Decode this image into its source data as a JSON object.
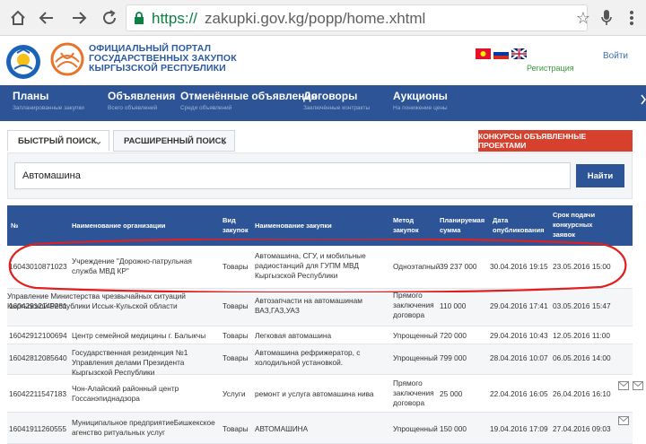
{
  "browser": {
    "url_protocol": "https://",
    "url_rest": "zakupki.gov.kg/popp/home.xhtml",
    "icons": [
      "home-icon",
      "back-icon",
      "forward-icon",
      "refresh-icon",
      "lock-icon",
      "star-icon",
      "mic-icon",
      "menu-icon"
    ]
  },
  "portal": {
    "title_lines": [
      "ОФИЦИАЛЬНЫЙ ПОРТАЛ",
      "ГОСУДАРСТВЕННЫХ ЗАКУПОК",
      "КЫРГЫЗСКОЙ РЕСПУБЛИКИ"
    ],
    "register": "Регистрация",
    "login": "Войти"
  },
  "nav": [
    {
      "label": "Планы",
      "sub": "Запланированные закупки"
    },
    {
      "label": "Объявления",
      "sub": "Всего объявлений"
    },
    {
      "label": "Отменённые объявления",
      "sub": "Среди объявлений"
    },
    {
      "label": "Договоры",
      "sub": "Заключённые контракты"
    },
    {
      "label": "Аукционы",
      "sub": "На понижение цены"
    }
  ],
  "search": {
    "quick_tab": "БЫСТРЫЙ ПОИСК",
    "advanced_tab": "РАСШИРЕННЫЙ ПОИСК",
    "projects_button": "КОНКУРСЫ ОБЪЯВЛЕННЫЕ ПРОЕКТАМИ",
    "query": "Автомашина",
    "find_button": "Найти"
  },
  "table": {
    "headers": [
      "№",
      "Наименование организации",
      "Вид закупок",
      "Наименование закупки",
      "Метод закупок",
      "Планируемая сумма",
      "Дата опубликования",
      "Срок подачи конкурсных заявок"
    ],
    "rows": [
      {
        "num": "16043010871023",
        "org": "Учреждение \"Дорожно-патрульная служба МВД КР\"",
        "kind": "Товары",
        "name": "Автомашина, СГУ, и мобильные радиостанций для ГУПМ МВД Кыргызской Республики",
        "method": "Одноэтапный",
        "sum": "39 237 000",
        "date": "30.04.2016 19:15",
        "deadline": "23.05.2016 15:00"
      },
      {
        "num": "16042912149281",
        "org": "Управление Министерства чрезвычайных ситуаций Кыргызской Республики Иссык-Кульской области",
        "kind": "Товары",
        "name": "Автозапчасти на автомашинам ВАЗ,ГАЗ,УАЗ",
        "method": "Прямого заключения договора",
        "sum": "110 000",
        "date": "29.04.2016 17:41",
        "deadline": "03.05.2016 15:47"
      },
      {
        "num": "16042912100694",
        "org": "Центр семейной медицины г. Балыкчы",
        "kind": "Товары",
        "name": "Легковая автомашина",
        "method": "Упрощенный",
        "sum": "720 000",
        "date": "29.04.2016 10:43",
        "deadline": "12.05.2016 11:00"
      },
      {
        "num": "16042812085640",
        "org": "Государственная резиденция №1 Управления делами Президента Кыргызской Республики",
        "kind": "Товары",
        "name": "Автомашина рефрижератор, с холодильной установкой.",
        "method": "Упрощенный",
        "sum": "799 000",
        "date": "28.04.2016 10:07",
        "deadline": "06.05.2016 14:00"
      },
      {
        "num": "16042211547183",
        "org": "Чон-Алайский районный центр Госсанэпиднадзора",
        "kind": "Услуги",
        "name": "ремонт и услуга автомашина нива",
        "method": "Прямого заключения договора",
        "sum": "25 000",
        "date": "22.04.2016 16:05",
        "deadline": "26.04.2016 16:10"
      },
      {
        "num": "16041911260555",
        "org": "Муниципальное предприятиеБишкекское агенство ритуальных услуг",
        "kind": "Товары",
        "name": "АВТОМАШИНА",
        "method": "Упрощенный",
        "sum": "150 000",
        "date": "19.04.2016 17:09",
        "deadline": "27.04.2016 09:03"
      }
    ]
  },
  "colors": {
    "nav_bg": "#2c5496",
    "red_button": "#d8402e",
    "url_green": "#0b8043",
    "oval": "#e02020"
  }
}
